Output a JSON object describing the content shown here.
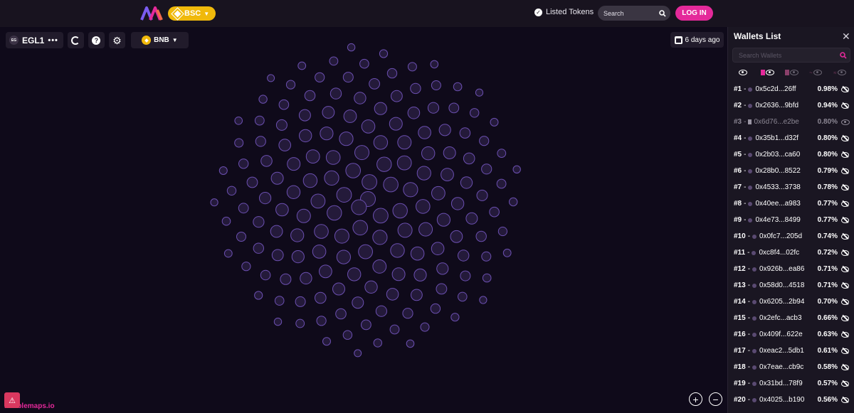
{
  "header": {
    "chain": "BSC",
    "listed_tokens": "Listed Tokens",
    "search_placeholder": "Search",
    "login": "LOG IN"
  },
  "map": {
    "token_avatar": "EG",
    "token_name": "EGL1",
    "more": "•••",
    "network": "BNB",
    "updated": "6 days ago",
    "brand": "bubblemaps.io",
    "zoom_in": "+",
    "zoom_out": "−"
  },
  "wallets": {
    "title": "Wallets List",
    "search_placeholder": "Search Wallets",
    "rows": [
      {
        "rank": "#1",
        "address": "0x5c2d...26ff",
        "percent": "0.98%"
      },
      {
        "rank": "#2",
        "address": "0x2636...9bfd",
        "percent": "0.94%"
      },
      {
        "rank": "#3",
        "address": "0x6d76...e2be",
        "percent": "0.80%",
        "contract": true
      },
      {
        "rank": "#4",
        "address": "0x35b1...d32f",
        "percent": "0.80%"
      },
      {
        "rank": "#5",
        "address": "0x2b03...ca60",
        "percent": "0.80%"
      },
      {
        "rank": "#6",
        "address": "0x28b0...8522",
        "percent": "0.79%"
      },
      {
        "rank": "#7",
        "address": "0x4533...3738",
        "percent": "0.78%"
      },
      {
        "rank": "#8",
        "address": "0x40ee...a983",
        "percent": "0.77%"
      },
      {
        "rank": "#9",
        "address": "0x4e73...8499",
        "percent": "0.77%"
      },
      {
        "rank": "#10",
        "address": "0x0fc7...205d",
        "percent": "0.74%"
      },
      {
        "rank": "#11",
        "address": "0xc8f4...02fc",
        "percent": "0.72%"
      },
      {
        "rank": "#12",
        "address": "0x926b...ea86",
        "percent": "0.71%"
      },
      {
        "rank": "#13",
        "address": "0x58d0...4518",
        "percent": "0.71%"
      },
      {
        "rank": "#14",
        "address": "0x6205...2b94",
        "percent": "0.70%"
      },
      {
        "rank": "#15",
        "address": "0x2efc...acb3",
        "percent": "0.66%"
      },
      {
        "rank": "#16",
        "address": "0x409f...622e",
        "percent": "0.63%"
      },
      {
        "rank": "#17",
        "address": "0xeac2...5db1",
        "percent": "0.61%"
      },
      {
        "rank": "#18",
        "address": "0x7eae...cb9c",
        "percent": "0.58%"
      },
      {
        "rank": "#19",
        "address": "0x31bd...78f9",
        "percent": "0.57%"
      },
      {
        "rank": "#20",
        "address": "0x4025...b190",
        "percent": "0.56%"
      }
    ]
  },
  "colors": {
    "accent": "#e4299a",
    "chain": "#f0b90b",
    "bubble_fill": "#241a3a",
    "bubble_stroke": "#6b4fb0"
  }
}
